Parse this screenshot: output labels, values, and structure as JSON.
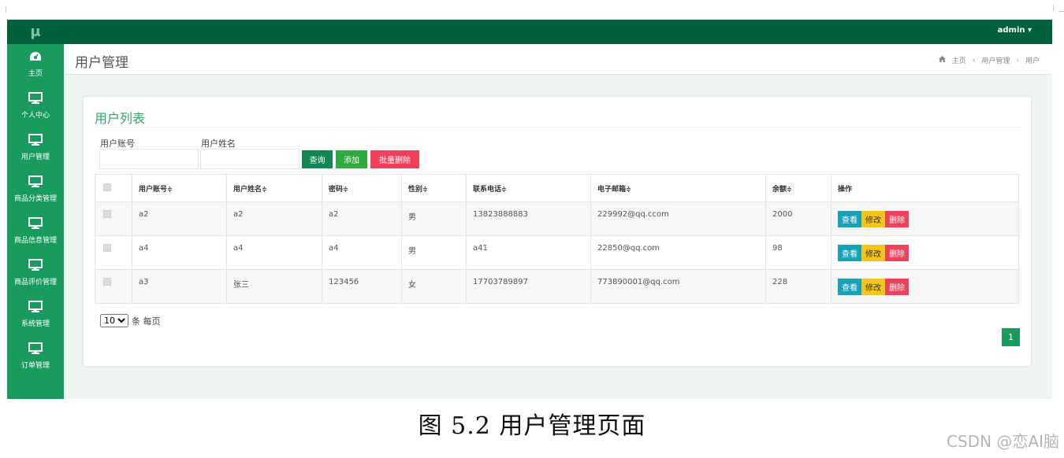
{
  "app": {
    "logo": "μ",
    "user_menu": "admin ▾"
  },
  "sidebar": {
    "items": [
      {
        "label": "主页",
        "icon": "dashboard-icon"
      },
      {
        "label": "个人中心",
        "icon": "monitor-icon"
      },
      {
        "label": "用户管理",
        "icon": "monitor-icon"
      },
      {
        "label": "商品分类管理",
        "icon": "monitor-icon"
      },
      {
        "label": "商品信息管理",
        "icon": "monitor-icon"
      },
      {
        "label": "商品评价管理",
        "icon": "monitor-icon"
      },
      {
        "label": "系统管理",
        "icon": "monitor-icon"
      },
      {
        "label": "订单管理",
        "icon": "monitor-icon"
      }
    ]
  },
  "header": {
    "title": "用户管理",
    "breadcrumb": [
      "主页",
      "用户管理",
      "用户"
    ],
    "home_icon": "home-icon"
  },
  "card": {
    "title": "用户列表",
    "filters": [
      {
        "label": "用户账号",
        "value": ""
      },
      {
        "label": "用户姓名",
        "value": ""
      }
    ],
    "buttons": {
      "search": "查询",
      "add": "添加",
      "batch_delete": "批量删除"
    }
  },
  "table": {
    "columns": [
      "用户账号",
      "用户姓名",
      "密码",
      "性别",
      "联系电话",
      "电子邮箱",
      "余额",
      "操作"
    ],
    "sort_glyph": "≑",
    "rows": [
      [
        "a2",
        "a2",
        "a2",
        "男",
        "13823888883",
        "229992@qq.ccom",
        "2000"
      ],
      [
        "a4",
        "a4",
        "a4",
        "男",
        "a41",
        "22850@qq.com",
        "98"
      ],
      [
        "a3",
        "张三",
        "123456",
        "女",
        "17703789897",
        "773890001@qq.com",
        "228"
      ]
    ],
    "row_actions": {
      "view": "查看",
      "edit": "修改",
      "delete": "删除"
    }
  },
  "pagination": {
    "page_size": "10",
    "per_page_label": "条 每页",
    "current_page": "1"
  },
  "caption": "图 5.2  用户管理页面",
  "watermark": "CSDN @恋AI脑",
  "colors": {
    "sidebar": "#1a9b5e",
    "topbar": "#00603a",
    "title_green": "#2fa766",
    "search_btn": "#12874f",
    "add_btn": "#2eaa3f",
    "delete_btn": "#f0415c",
    "view_btn": "#17a2b8",
    "edit_btn": "#f5c518"
  }
}
